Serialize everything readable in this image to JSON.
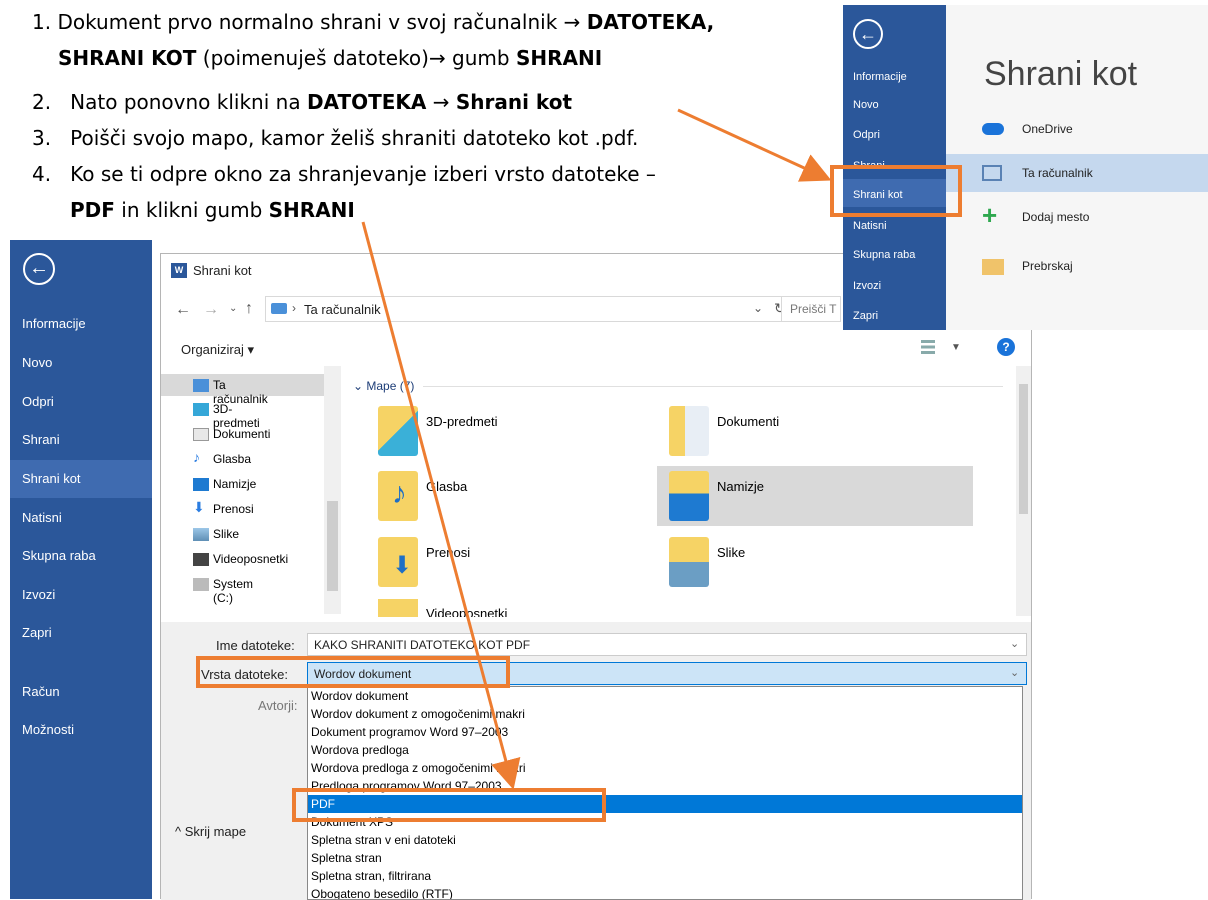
{
  "instructions": {
    "step1_num": "1.",
    "step1_line1_a": "Dokument prvo normalno shrani v svoj računalnik",
    "step1_line1_b": "DATOTEKA,",
    "step1_line2_a": "SHRANI KOT",
    "step1_line2_b": " (poimenuješ datoteko)",
    "step1_line2_c": " gumb ",
    "step1_line2_d": "SHRANI",
    "step2_num": "2.",
    "step2_a": "Nato ponovno klikni na ",
    "step2_b": "DATOTEKA",
    "step2_c": "Shrani kot",
    "step3_num": "3.",
    "step3_a": "Poišči svojo mapo, kamor želiš shraniti datoteko kot .pdf.",
    "step4_num": "4.",
    "step4_line1": "Ko se ti odpre okno za shranjevanje izberi vrsto datoteke –",
    "step4_line2_a": "PDF",
    "step4_line2_b": " in klikni gumb ",
    "step4_line2_c": "SHRANI"
  },
  "topright": {
    "nav_items": [
      "Informacije",
      "Novo",
      "Odpri",
      "Shrani",
      "Shrani kot",
      "Natisni",
      "Skupna raba",
      "Izvozi",
      "Zapri"
    ],
    "title": "Shrani kot",
    "locations": [
      "OneDrive",
      "Ta računalnik",
      "Dodaj mesto",
      "Prebrskaj"
    ]
  },
  "leftnav": {
    "items": [
      "Informacije",
      "Novo",
      "Odpri",
      "Shrani",
      "Shrani kot",
      "Natisni",
      "Skupna raba",
      "Izvozi",
      "Zapri"
    ],
    "bottom": [
      "Račun",
      "Možnosti"
    ]
  },
  "dialog": {
    "title": "Shrani kot",
    "path": "Ta računalnik",
    "search_placeholder": "Preišči T",
    "organize": "Organiziraj ▾",
    "tree": [
      "Ta računalnik",
      "3D-predmeti",
      "Dokumenti",
      "Glasba",
      "Namizje",
      "Prenosi",
      "Slike",
      "Videoposnetki",
      "System (C:)"
    ],
    "group_header": "Mape (7)",
    "folders": [
      "3D-predmeti",
      "Dokumenti",
      "Glasba",
      "Namizje",
      "Prenosi",
      "Slike",
      "Videoposnetki"
    ],
    "filename_label": "Ime datoteke:",
    "filename_value": "KAKO SHRANITI DATOTEKO KOT PDF",
    "filetype_label": "Vrsta datoteke:",
    "filetype_value": "Wordov dokument",
    "authors_label": "Avtorji:",
    "hide_folders": "Skrij mape",
    "filetype_options": [
      "Wordov dokument",
      "Wordov dokument z omogočenimi makri",
      "Dokument programov Word 97–2003",
      "Wordova predloga",
      "Wordova predloga z omogočenimi makri",
      "Predloga programov Word 97–2003",
      "PDF",
      "Dokument XPS",
      "Spletna stran v eni datoteki",
      "Spletna stran",
      "Spletna stran, filtrirana",
      "Obogateno besedilo (RTF)"
    ],
    "selected_option_index": 6
  },
  "colors": {
    "word_blue": "#2b579a",
    "accent_orange": "#ed7d31",
    "selection_blue": "#0078d7"
  }
}
